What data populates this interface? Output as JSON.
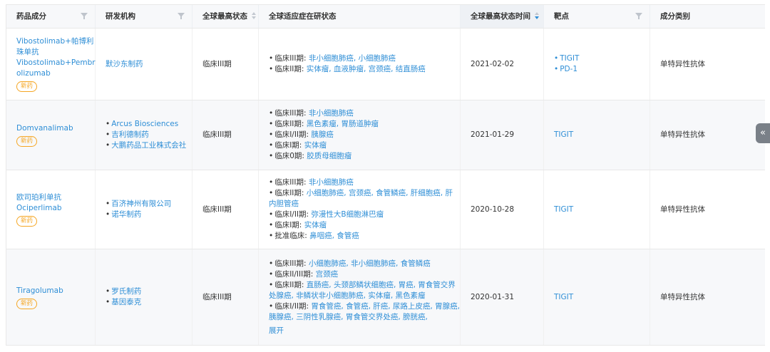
{
  "headers": {
    "drug": "药品成分",
    "org": "研发机构",
    "status": "全球最高状态",
    "indications": "全球适应症在研状态",
    "date": "全球最高状态时间",
    "target": "靶点",
    "category": "成分类别"
  },
  "badge_label": "新药",
  "rows": [
    {
      "drug": "Vibostolimab+帕博利\n珠单抗\nVibostolimab+Pembr\nolizumab",
      "orgs": [
        "默沙东制药"
      ],
      "status": "临床III期",
      "indications": [
        {
          "phase": "临床III期: ",
          "diseases": "非小细胞肺癌, 小细胞肺癌"
        },
        {
          "phase": "临床II期: ",
          "diseases": "实体瘤, 血液肿瘤, 宫颈癌, 结直肠癌"
        }
      ],
      "date": "2021-02-02",
      "targets": [
        "TIGIT",
        "PD-1"
      ],
      "category": "单特异性抗体"
    },
    {
      "drug": "Domvanalimab",
      "orgs": [
        "Arcus Biosciences",
        "吉利德制药",
        "大鹏药品工业株式会社"
      ],
      "status": "临床III期",
      "indications": [
        {
          "phase": "临床III期: ",
          "diseases": "非小细胞肺癌"
        },
        {
          "phase": "临床II期: ",
          "diseases": "黑色素瘤, 胃肠道肿瘤"
        },
        {
          "phase": "临床I/II期: ",
          "diseases": "胰腺癌"
        },
        {
          "phase": "临床I期: ",
          "diseases": "实体瘤"
        },
        {
          "phase": "临床0期: ",
          "diseases": "胶质母细胞瘤"
        }
      ],
      "date": "2021-01-29",
      "targets": [
        "TIGIT"
      ],
      "category": "单特异性抗体"
    },
    {
      "drug": "欧司珀利单抗\nOciperlimab",
      "orgs": [
        "百济神州有限公司",
        "诺华制药"
      ],
      "status": "临床III期",
      "indications": [
        {
          "phase": "临床III期: ",
          "diseases": "非小细胞肺癌"
        },
        {
          "phase": "临床II期: ",
          "diseases": "小细胞肺癌, 宫颈癌, 食管鳞癌, 肝细胞癌, 肝内胆管癌"
        },
        {
          "phase": "临床I/II期: ",
          "diseases": "弥漫性大B细胞淋巴瘤"
        },
        {
          "phase": "临床I期: ",
          "diseases": "实体瘤"
        },
        {
          "phase": "批准临床: ",
          "diseases": "鼻咽癌, 食管癌"
        }
      ],
      "date": "2020-10-28",
      "targets": [
        "TIGIT"
      ],
      "category": "单特异性抗体"
    },
    {
      "drug": "Tiragolumab",
      "orgs": [
        "罗氏制药",
        "基因泰克"
      ],
      "status": "临床III期",
      "indications": [
        {
          "phase": "临床III期: ",
          "diseases": "小细胞肺癌, 非小细胞肺癌, 食管鳞癌"
        },
        {
          "phase": "临床II/III期: ",
          "diseases": "宫颈癌"
        },
        {
          "phase": "临床II期: ",
          "diseases": "直肠癌, 头颈部鳞状细胞癌, 胃癌, 胃食管交界处腺癌, 非鳞状非小细胞肺癌, 实体瘤, 黑色素瘤"
        },
        {
          "phase": "临床I/II期: ",
          "diseases": "胃食管癌, 食管癌, 肝癌, 尿路上皮癌, 胃腺癌, 胰腺癌, 三阴性乳腺癌, 胃食管交界处癌, 膀胱癌,"
        }
      ],
      "expand_label": "展开",
      "date": "2020-01-31",
      "targets": [
        "TIGIT"
      ],
      "category": "单特异性抗体"
    }
  ],
  "side_tab_icon": "«"
}
